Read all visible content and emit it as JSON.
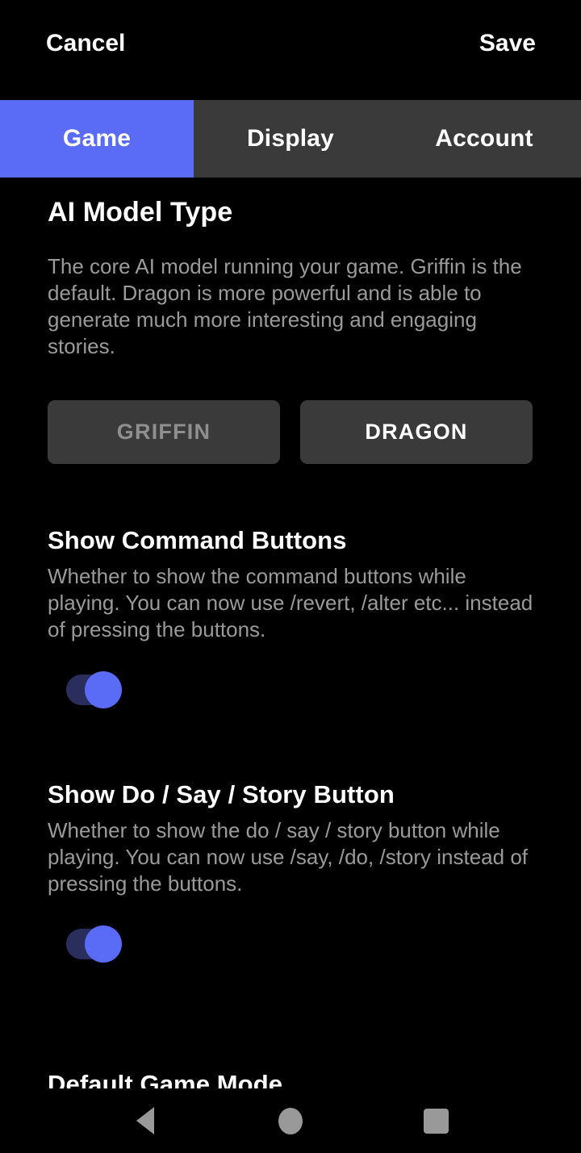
{
  "topbar": {
    "cancel_label": "Cancel",
    "save_label": "Save"
  },
  "tabs": [
    {
      "label": "Game",
      "active": true
    },
    {
      "label": "Display",
      "active": false
    },
    {
      "label": "Account",
      "active": false
    }
  ],
  "sections": {
    "ai_model": {
      "heading": "AI Model Type",
      "description": "The core AI model running your game. Griffin is the default. Dragon is more powerful and is able to generate much more interesting and engaging stories.",
      "options": [
        {
          "label": "GRIFFIN",
          "selected": false
        },
        {
          "label": "DRAGON",
          "selected": true
        }
      ]
    },
    "command_buttons": {
      "heading": "Show Command Buttons",
      "description": "Whether to show the command buttons while playing. You can now use /revert, /alter etc... instead of pressing the buttons.",
      "toggle_state": "on"
    },
    "do_say_story": {
      "heading": "Show Do / Say / Story Button",
      "description": "Whether to show the do / say / story button while playing. You can now use /say, /do, /story instead of pressing the buttons.",
      "toggle_state": "on"
    },
    "default_game_mode": {
      "heading": "Default Game Mode"
    }
  },
  "navbar": {
    "back": "back-icon",
    "home": "home-icon",
    "recent": "recent-apps-icon"
  },
  "colors": {
    "background": "#000000",
    "accent": "#5a6bf5",
    "tab_inactive": "#3a3a3a",
    "button_bg": "#3a3a3a",
    "text_primary": "#ffffff",
    "text_secondary": "#9a9a9a",
    "text_disabled": "#8f8f8f",
    "toggle_track_on": "#2a2e5c",
    "nav_icon": "#999999"
  }
}
